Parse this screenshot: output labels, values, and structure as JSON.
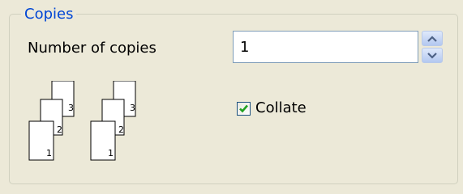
{
  "group": {
    "title": "Copies"
  },
  "copies": {
    "label": "Number of copies",
    "value": "1"
  },
  "collate": {
    "label": "Collate",
    "checked": true
  },
  "illustration": {
    "stack_numbers": [
      "1",
      "2",
      "3"
    ]
  },
  "icons": {
    "spinner_up": "spin-up-arrow-icon",
    "spinner_down": "spin-down-arrow-icon",
    "check": "checkmark-icon"
  },
  "colors": {
    "group_title": "#0046d5",
    "checkmark": "#21a121",
    "background": "#ece9d8"
  }
}
